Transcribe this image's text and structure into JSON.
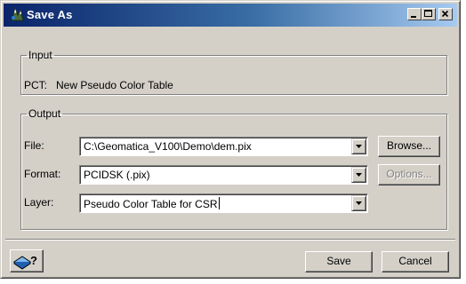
{
  "window": {
    "title": "Save As"
  },
  "input_group": {
    "legend": "Input",
    "pct_label": "PCT:",
    "pct_value": "New Pseudo Color Table"
  },
  "output_group": {
    "legend": "Output",
    "file_label": "File:",
    "file_value": "C:\\Geomatica_V100\\Demo\\dem.pix",
    "browse_label": "Browse...",
    "format_label": "Format:",
    "format_value": "PCIDSK (.pix)",
    "options_label": "Options...",
    "layer_label": "Layer:",
    "layer_value": "Pseudo Color Table for CSR"
  },
  "footer": {
    "help_icon": "help-book-icon",
    "save_label": "Save",
    "cancel_label": "Cancel"
  },
  "colors": {
    "titlebar_start": "#0a246a",
    "titlebar_end": "#a6caf0",
    "face": "#d4d0c8"
  }
}
